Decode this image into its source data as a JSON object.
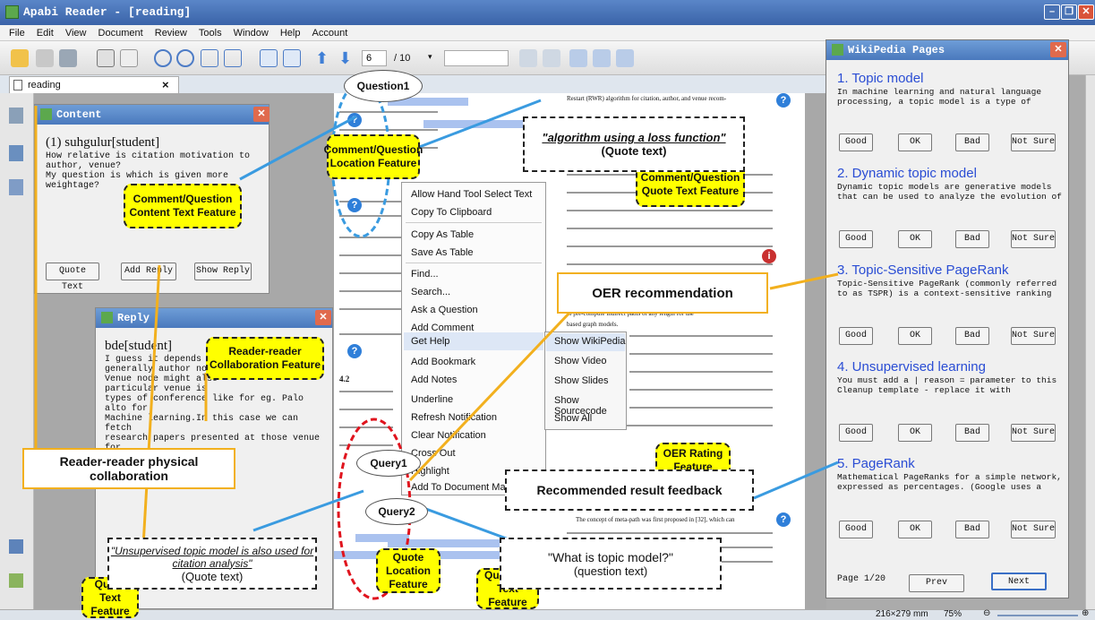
{
  "app": {
    "title": "Apabi Reader - [reading]",
    "menu": [
      "File",
      "Edit",
      "View",
      "Document",
      "Review",
      "Tools",
      "Window",
      "Help",
      "Account"
    ],
    "page_current": "6",
    "page_total": "/ 10",
    "tab_label": "reading",
    "tab_close": "×",
    "zoom": "75%",
    "page_size": "216×279 mm"
  },
  "content_panel": {
    "title": "Content",
    "author": "(1) suhgulur[student]",
    "body": "How relative is citation motivation to\nauthor, venue?\nMy question is which is given more weightage?",
    "buttons": [
      "Quote Text",
      "Add Reply",
      "Show Reply"
    ]
  },
  "reply_panel": {
    "title": "Reply",
    "author": "bde[student]",
    "body": "I guess it depends on\ngenerally author nodes\nVenue node might also\nparticular venue is\ntypes of conference like for eg. Palo alto for\nMachine learning.In this case we can fetch\nresearch papers presented at those venue for\ncitation recommendation."
  },
  "context_menu": {
    "items": [
      "Allow Hand Tool Select Text",
      "Copy To Clipboard",
      "Copy As Table",
      "Save As Table",
      "Find...",
      "Search...",
      "Ask a Question",
      "Add Comment",
      "Get Help",
      "Add Bookmark",
      "Add Notes",
      "Underline",
      "Refresh Notification",
      "Clear Notification",
      "Cross Out",
      "Highlight",
      "Add To Document Manager"
    ],
    "submenu": [
      "Show WikiPedia",
      "Show Video",
      "Show Slides",
      "Show Sourcecode",
      "Show All"
    ]
  },
  "wiki_panel": {
    "title": "WikiPedia Pages",
    "rating_buttons": [
      "Good",
      "OK",
      "Bad",
      "Not Sure"
    ],
    "entries": [
      {
        "title": "1. Topic model",
        "desc": "In machine learning and natural language processing, a topic model is a type of"
      },
      {
        "title": "2. Dynamic topic model",
        "desc": "Dynamic topic models are generative models that can be used to analyze the evolution of"
      },
      {
        "title": "3. Topic-Sensitive PageRank",
        "desc": "Topic-Sensitive PageRank (commonly referred to as TSPR) is a context-sensitive ranking"
      },
      {
        "title": "4. Unsupervised learning",
        "desc": "You must add a  |  reason =  parameter to this Cleanup template - replace it with"
      },
      {
        "title": "5. PageRank",
        "desc": "Mathematical PageRanks for a simple network, expressed as percentages. (Google uses a"
      }
    ],
    "page_indicator": "Page 1/20",
    "prev": "Prev",
    "next": "Next"
  },
  "annotations": {
    "question1": "Question1",
    "query1": "Query1",
    "query2": "Query2",
    "comment_location": "Comment/Question Location Feature",
    "comment_quote": "Comment/Question Quote Text Feature",
    "comment_content": "Comment/Question Content Text Feature",
    "reader_collab": "Reader-reader Collaboration Feature",
    "reader_physical": "Reader-reader physical collaboration",
    "oer_recommendation": "OER recommendation",
    "oer_rating": "OER Rating Feature",
    "recommended_feedback": "Recommended result feedback",
    "quote_loss_a": "\"algorithm using a loss function\"",
    "quote_loss_b": "(Quote text)",
    "quote_unsup_a": "\"Unsupervised topic model is also used for citation analysis\"",
    "quote_unsup_b": "(Quote text)",
    "question_topic_a": "\"What is topic model?\"",
    "question_topic_b": "(question text)",
    "quote_text_feature": "Quote Text Feature",
    "quote_location_feature": "Quote Location Feature",
    "question_text_feature": "Question Text Feature",
    "section": "4.2",
    "page_text_1": "Restart (RWR) algorithm for citation, author, and venue recom-",
    "page_text_2": "to pre-compute indirect paths of any length for use",
    "page_text_3": "based graph models.",
    "page_text_4": "The concept of meta-path was first proposed in [32], which can"
  }
}
